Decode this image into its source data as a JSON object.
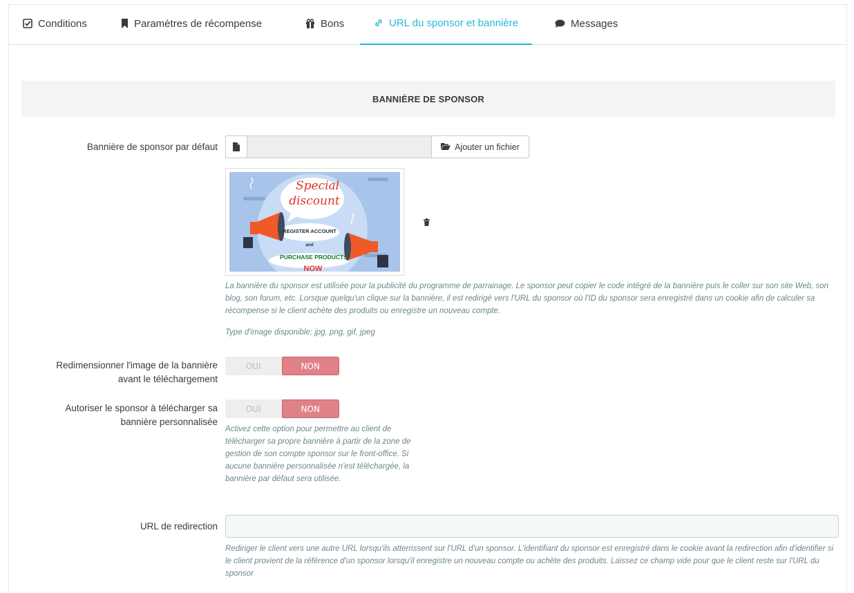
{
  "tabs": [
    {
      "label": "Conditions",
      "icon": "check-square-icon"
    },
    {
      "label": "Paramètres de récompense",
      "icon": "bookmark-icon"
    },
    {
      "label": "Bons",
      "icon": "gift-icon"
    },
    {
      "label": "URL du sponsor et bannière",
      "icon": "link-icon",
      "active": true
    },
    {
      "label": "Messages",
      "icon": "comment-icon"
    }
  ],
  "section_title": "BANNIÈRE DE SPONSOR",
  "default_banner": {
    "label": "Bannière de sponsor par défaut",
    "button_label": "Ajouter un fichier",
    "help": "La bannière du sponsor est utilisée pour la publicité du programme de parrainage. Le sponsor peut copier le code intégré de la bannière puis le coller sur son site Web, son blog, son forum, etc. Lorsque quelqu'un clique sur la bannière, il est redirigé vers l'URL du sponsor où l'ID du sponsor sera enregistré dans un cookie afin de calculer sa récompense si le client achète des produits ou enregistre un nouveau compte.",
    "image_types": "Type d'image disponible: jpg, png, gif, jpeg"
  },
  "banner_image": {
    "line1": "Special",
    "line2": "discount",
    "register": "REGISTER ACCOUNT",
    "and": "and",
    "purchase": "PURCHASE PRODUCTS",
    "now": "NOW"
  },
  "resize": {
    "label_line1": "Redimensionner l'image de la bannière",
    "label_line2": "avant le téléchargement",
    "yes": "OUI",
    "no": "NON",
    "value": "NON"
  },
  "allow_custom": {
    "label_line1": "Autoriser le sponsor à télécharger sa",
    "label_line2": "bannière personnalisée",
    "yes": "OUI",
    "no": "NON",
    "value": "NON",
    "help": "Activez cette option pour permettre au client de télécharger sa propre bannière à partir de la zone de gestion de son compte sponsor sur le front-office. Si aucune bannière personnalisée n'est téléchargée, la bannière par défaut sera utilisée."
  },
  "redirect": {
    "label": "URL de redirection",
    "value": "",
    "help": "Rediriger le client vers une autre URL lorsqu'ils atterrissent sur l'URL d'un sponsor. L'identifiant du sponsor est enregistré dans le cookie avant la redirection afin d'identifier si le client provient de la référence d'un sponsor lorsqu'il enregistre un nouveau compte ou achète des produits. Laissez ce champ vide pour que le client reste sur l'URL du sponsor"
  },
  "colors": {
    "accent": "#25b9d7",
    "switch_off_active": "#e08188"
  }
}
